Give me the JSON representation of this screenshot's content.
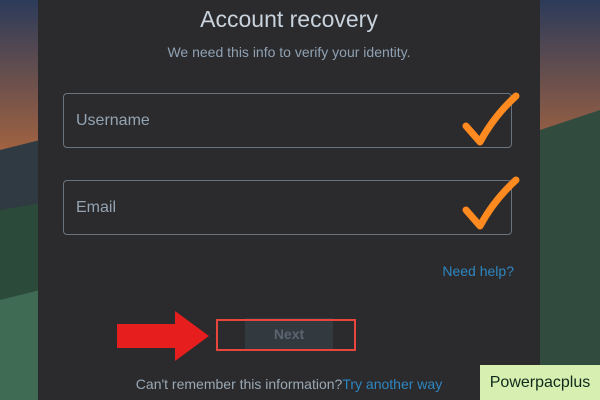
{
  "header": {
    "title": "Account recovery",
    "subtitle": "We need this info to verify your identity."
  },
  "form": {
    "username_label": "Username",
    "email_label": "Email"
  },
  "links": {
    "need_help": "Need help?",
    "cant_remember": "Can't remember this information?",
    "try_another": "Try another way"
  },
  "buttons": {
    "next_label": "Next"
  },
  "brand": {
    "label": "Powerpacplus"
  },
  "icons": {
    "check_color": "#ff8a1f",
    "arrow_color": "#e61e1e",
    "highlight_color": "#e8453c"
  }
}
